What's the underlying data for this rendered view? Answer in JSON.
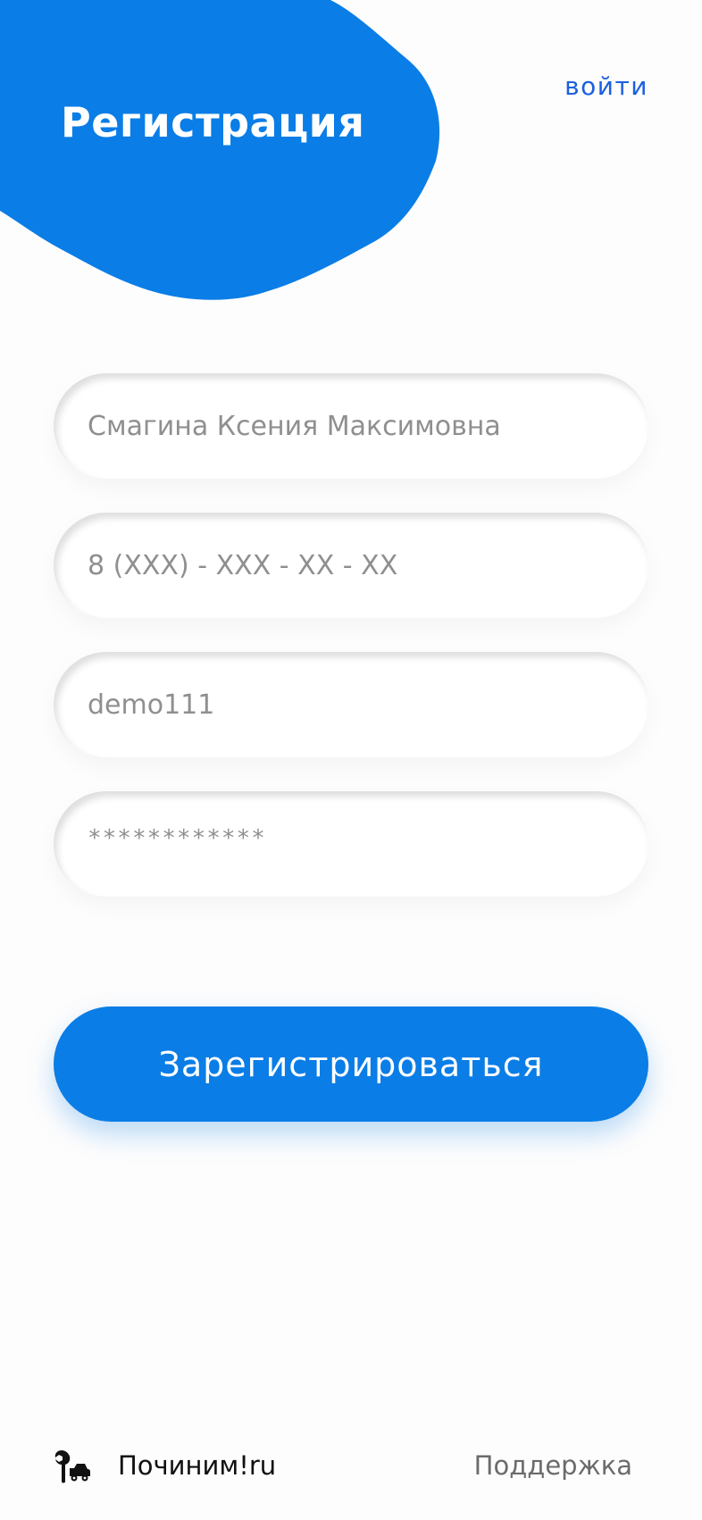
{
  "header": {
    "title": "Регистрация",
    "login_link": "войти"
  },
  "form": {
    "full_name": {
      "placeholder": "Смагина Ксения Максимовна"
    },
    "phone": {
      "placeholder": "8 (XXX) - XXX - XX - XX"
    },
    "login": {
      "placeholder": "demo111"
    },
    "password": {
      "placeholder": "************"
    },
    "submit_label": "Зарегистрироваться"
  },
  "footer": {
    "brand": "Починим!ru",
    "support": "Поддержка"
  },
  "colors": {
    "accent": "#0a7de6",
    "link": "#1b5fe0",
    "background": "#fdfdfd"
  },
  "icons": {
    "brand_icon": "wrench-car-icon"
  }
}
